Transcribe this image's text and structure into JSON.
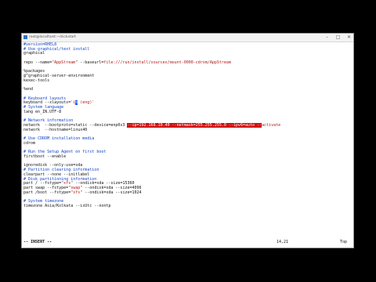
{
  "window": {
    "title": "root@localhost:~/kickstart",
    "minimize_label": "–",
    "maximize_label": "□",
    "close_label": "✕"
  },
  "colors": {
    "comment": "#1040c8",
    "string": "#b01818",
    "search_highlight": "#d01010",
    "cursor": "#1e58ff"
  },
  "editor": {
    "lines": [
      [
        {
          "t": "#version=RHEL8",
          "c": "comment"
        }
      ],
      [
        {
          "t": "# Use graphical/text install",
          "c": "comment"
        }
      ],
      [
        {
          "t": "graphical"
        }
      ],
      [
        {
          "t": ""
        }
      ],
      [
        {
          "t": "repo --name="
        },
        {
          "t": "\"AppStream\"",
          "c": "str"
        },
        {
          "t": " --baseurl="
        },
        {
          "t": "file:///run/install/sources/mount-0000-cdrom/AppStream",
          "c": "str"
        }
      ],
      [
        {
          "t": ""
        }
      ],
      [
        {
          "t": "%packages"
        }
      ],
      [
        {
          "t": "@^graphical-server-environment"
        }
      ],
      [
        {
          "t": "kexec-tools"
        }
      ],
      [
        {
          "t": ""
        }
      ],
      [
        {
          "t": "%end"
        }
      ],
      [
        {
          "t": ""
        }
      ],
      [
        {
          "t": "# Keyboard layouts",
          "c": "comment"
        }
      ],
      [
        {
          "t": "keyboard --xlayouts="
        },
        {
          "t": "'i",
          "c": "str"
        },
        {
          "t": "n",
          "c": "cursor"
        },
        {
          "t": " (eng)'",
          "c": "str"
        }
      ],
      [
        {
          "t": "# System language",
          "c": "comment"
        }
      ],
      [
        {
          "t": "lang en_IN.UTF-8"
        }
      ],
      [
        {
          "t": ""
        }
      ],
      [
        {
          "t": "# Network information",
          "c": "comment"
        }
      ],
      [
        {
          "t": "network  --bootproto=static --device=enp0s3 "
        },
        {
          "t": "--ip=192.168.10.40 --netmask=255.255.255.0 --ipv6=auto --",
          "c": "hl"
        },
        {
          "t": "activate",
          "c": "str"
        }
      ],
      [
        {
          "t": "network  --hostname=linux40"
        }
      ],
      [
        {
          "t": ""
        }
      ],
      [
        {
          "t": "# Use CDROM installation media",
          "c": "comment"
        }
      ],
      [
        {
          "t": "cdrom"
        }
      ],
      [
        {
          "t": ""
        }
      ],
      [
        {
          "t": "# Run the Setup Agent on first boot",
          "c": "comment"
        }
      ],
      [
        {
          "t": "firstboot --enable"
        }
      ],
      [
        {
          "t": ""
        }
      ],
      [
        {
          "t": "ignoredisk --only-use=sda"
        }
      ],
      [
        {
          "t": "# Partition clearing information",
          "c": "comment"
        }
      ],
      [
        {
          "t": "clearpart --none --initlabel"
        }
      ],
      [
        {
          "t": "# Disk partitioning information",
          "c": "comment"
        }
      ],
      [
        {
          "t": "part / --fstype="
        },
        {
          "t": "\"xfs\"",
          "c": "str"
        },
        {
          "t": " --ondisk=sda --size=15360"
        }
      ],
      [
        {
          "t": "part swap --fstype="
        },
        {
          "t": "\"swap\"",
          "c": "str"
        },
        {
          "t": " --ondisk=sda --size=4096"
        }
      ],
      [
        {
          "t": "part /boot --fstype="
        },
        {
          "t": "\"xfs\"",
          "c": "str"
        },
        {
          "t": " --ondisk=sda --size=1024"
        }
      ],
      [
        {
          "t": ""
        }
      ],
      [
        {
          "t": "# System timezone",
          "c": "comment"
        }
      ],
      [
        {
          "t": "timezone Asia/Kolkata --isUtc --nontp"
        }
      ]
    ]
  },
  "status": {
    "mode": "-- INSERT --",
    "position": "14,21",
    "scroll": "Top"
  }
}
